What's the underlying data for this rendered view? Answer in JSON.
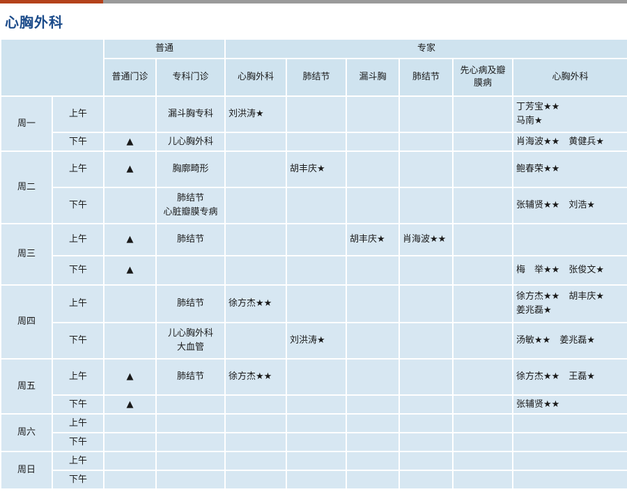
{
  "title": "心胸外科",
  "colors": {
    "title": "#1b4b8a",
    "accent_bar": "#b4421b",
    "cell_bg": "#d7e7f2"
  },
  "header": {
    "group_general": "普通",
    "group_expert": "专家",
    "columns": [
      "普通门诊",
      "专科门诊",
      "心胸外科",
      "肺结节",
      "漏斗胸",
      "肺结节",
      "先心病及瓣膜病",
      "心胸外科"
    ]
  },
  "symbols": {
    "triangle": "▲"
  },
  "days": [
    {
      "day": "周一",
      "slots": [
        {
          "period": "上午",
          "general": "",
          "specialty": "漏斗胸专科",
          "thoracic": "刘洪涛★",
          "nodule1": "",
          "funnel": "",
          "nodule2": "",
          "chd": "",
          "expert": [
            "丁芳宝★★",
            "马南★"
          ]
        },
        {
          "period": "下午",
          "general": "▲",
          "specialty": "儿心胸外科",
          "thoracic": "",
          "nodule1": "",
          "funnel": "",
          "nodule2": "",
          "chd": "",
          "expert": [
            "肖海波★★　黄健兵★"
          ]
        }
      ]
    },
    {
      "day": "周二",
      "slots": [
        {
          "period": "上午",
          "general": "▲",
          "specialty": "胸廓畸形",
          "thoracic": "",
          "nodule1": "胡丰庆★",
          "funnel": "",
          "nodule2": "",
          "chd": "",
          "expert": [
            "鲍春荣★★"
          ]
        },
        {
          "period": "下午",
          "general": "",
          "specialty": "肺结节\n心脏瓣膜专病",
          "thoracic": "",
          "nodule1": "",
          "funnel": "",
          "nodule2": "",
          "chd": "",
          "expert": [
            "张辅贤★★　刘浩★"
          ]
        }
      ]
    },
    {
      "day": "周三",
      "slots": [
        {
          "period": "上午",
          "general": "▲",
          "specialty": "肺结节",
          "thoracic": "",
          "nodule1": "",
          "funnel": "胡丰庆★",
          "nodule2": "肖海波★★",
          "chd": "",
          "expert": []
        },
        {
          "period": "下午",
          "general": "▲",
          "specialty": "",
          "thoracic": "",
          "nodule1": "",
          "funnel": "",
          "nodule2": "",
          "chd": "",
          "expert": [
            "梅　举★★　张俊文★"
          ]
        }
      ]
    },
    {
      "day": "周四",
      "slots": [
        {
          "period": "上午",
          "general": "",
          "specialty": "肺结节",
          "thoracic": "徐方杰★★",
          "nodule1": "",
          "funnel": "",
          "nodule2": "",
          "chd": "",
          "expert": [
            "徐方杰★★　胡丰庆★",
            "姜兆磊★"
          ]
        },
        {
          "period": "下午",
          "general": "",
          "specialty": "儿心胸外科\n大血管",
          "thoracic": "",
          "nodule1": "刘洪涛★",
          "funnel": "",
          "nodule2": "",
          "chd": "",
          "expert": [
            "汤敏★★　姜兆磊★"
          ]
        }
      ]
    },
    {
      "day": "周五",
      "slots": [
        {
          "period": "上午",
          "general": "▲",
          "specialty": "肺结节",
          "thoracic": "徐方杰★★",
          "nodule1": "",
          "funnel": "",
          "nodule2": "",
          "chd": "",
          "expert": [
            "徐方杰★★　王磊★"
          ]
        },
        {
          "period": "下午",
          "general": "▲",
          "specialty": "",
          "thoracic": "",
          "nodule1": "",
          "funnel": "",
          "nodule2": "",
          "chd": "",
          "expert": [
            "张辅贤★★"
          ]
        }
      ]
    },
    {
      "day": "周六",
      "slots": [
        {
          "period": "上午",
          "general": "",
          "specialty": "",
          "thoracic": "",
          "nodule1": "",
          "funnel": "",
          "nodule2": "",
          "chd": "",
          "expert": []
        },
        {
          "period": "下午",
          "general": "",
          "specialty": "",
          "thoracic": "",
          "nodule1": "",
          "funnel": "",
          "nodule2": "",
          "chd": "",
          "expert": []
        }
      ]
    },
    {
      "day": "周日",
      "slots": [
        {
          "period": "上午",
          "general": "",
          "specialty": "",
          "thoracic": "",
          "nodule1": "",
          "funnel": "",
          "nodule2": "",
          "chd": "",
          "expert": []
        },
        {
          "period": "下午",
          "general": "",
          "specialty": "",
          "thoracic": "",
          "nodule1": "",
          "funnel": "",
          "nodule2": "",
          "chd": "",
          "expert": []
        }
      ]
    }
  ]
}
